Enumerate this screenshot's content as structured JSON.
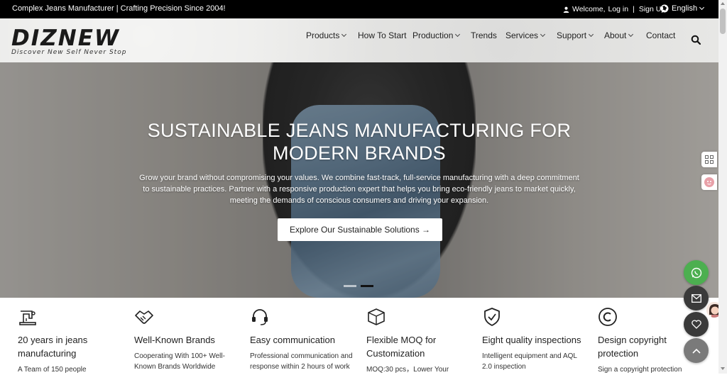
{
  "topbar": {
    "tagline": "Complex Jeans Manufacturer | Crafting Precision Since 2004!",
    "welcome": "Welcome,",
    "login": "Log in",
    "separator": "|",
    "signup": "Sign Up",
    "language": "English"
  },
  "header": {
    "logo_text": "DIZNEW",
    "logo_slogan": "Discover New Self Never Stop",
    "nav": [
      {
        "label": "Products",
        "dropdown": true
      },
      {
        "label": "How To Start",
        "dropdown": false
      },
      {
        "label": "Production",
        "dropdown": true
      },
      {
        "label": "Trends",
        "dropdown": false
      },
      {
        "label": "Services",
        "dropdown": true
      },
      {
        "label": "Support",
        "dropdown": true
      },
      {
        "label": "About",
        "dropdown": true
      },
      {
        "label": "Contact",
        "dropdown": false
      }
    ]
  },
  "hero": {
    "title_line1": "SUSTAINABLE JEANS MANUFACTURING FOR",
    "title_line2": "MODERN BRANDS",
    "description": "Grow your brand without compromising your values. We combine fast-track, full-service manufacturing with a deep commitment to sustainable practices. Partner with a responsive production expert that helps you bring eco-friendly jeans to market quickly, meeting the demands of conscious consumers and driving your expansion.",
    "cta": "Explore Our Sustainable Solutions →",
    "slides": 2,
    "active_slide": 2
  },
  "features": [
    {
      "icon": "sewing-machine-icon",
      "title": "20 years in jeans manufacturing",
      "desc": "A Team of 150 people"
    },
    {
      "icon": "handshake-icon",
      "title": "Well-Known Brands",
      "desc": "Cooperating With 100+ Well-Known Brands Worldwide"
    },
    {
      "icon": "headset-icon",
      "title": "Easy communication",
      "desc": "Professional communication and response within 2 hours of work"
    },
    {
      "icon": "box-icon",
      "title": "Flexible MOQ for Customization",
      "desc": "MOQ:30 pcs，Lower Your"
    },
    {
      "icon": "shield-check-icon",
      "title": "Eight quality inspections",
      "desc": "Intelligent equipment and AQL 2.0 inspection"
    },
    {
      "icon": "copyright-icon",
      "title": "Design copyright protection",
      "desc": "Sign a copyright protection"
    }
  ],
  "floating": {
    "whatsapp_color": "#4caf50",
    "dark_color": "#3a3a3a"
  }
}
